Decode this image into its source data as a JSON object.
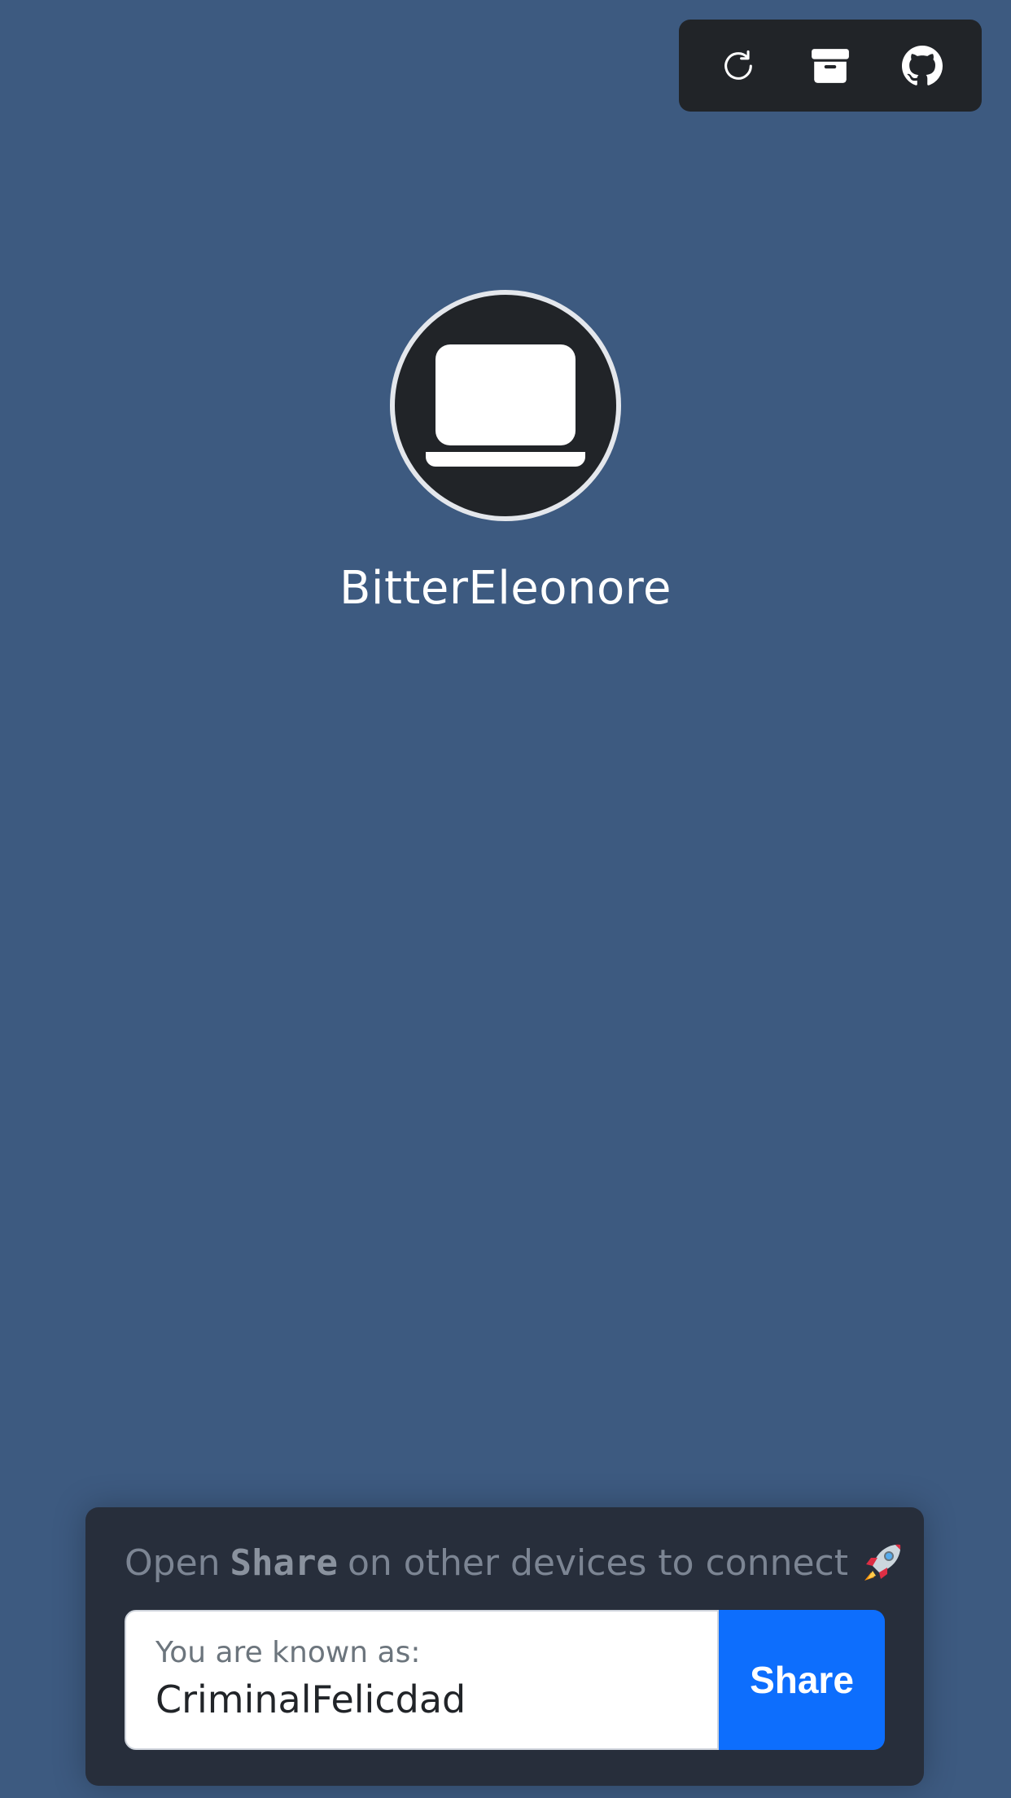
{
  "toolbar": {
    "items": [
      {
        "name": "refresh",
        "icon": "refresh-icon"
      },
      {
        "name": "archive",
        "icon": "archive-icon"
      },
      {
        "name": "github",
        "icon": "github-icon"
      }
    ]
  },
  "peer": {
    "name": "BitterEleonore",
    "icon": "laptop-icon"
  },
  "footer": {
    "prefix": "Open",
    "brand": "Share",
    "suffix": "on other devices to connect",
    "emoji_icon": "rocket-icon",
    "known_as_label": "You are known as:",
    "known_as_name": "CriminalFelicdad",
    "share_button": "Share"
  },
  "colors": {
    "background": "#3d5a80",
    "toolbar": "#212428",
    "panel": "#272e3b",
    "accent": "#0d6efd"
  }
}
